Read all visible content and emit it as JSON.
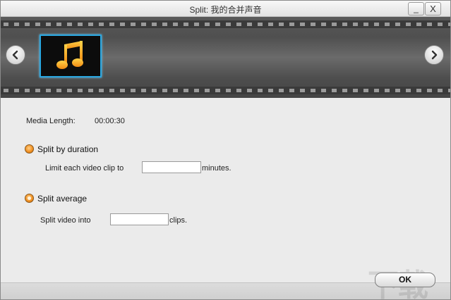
{
  "window": {
    "title": "Split: 我的合并声音",
    "minimize_label": "_",
    "close_label": "X"
  },
  "filmstrip": {
    "prev_icon": "chevron-left-icon",
    "next_icon": "chevron-right-icon",
    "selected_item_icon": "music-note-icon",
    "accent_color": "#2aa7e0"
  },
  "media": {
    "length_label": "Media Length:",
    "length_value": "00:00:30"
  },
  "split_by_duration": {
    "label": "Split by duration",
    "limit_label": "Limit each video clip to",
    "minutes_value": "",
    "minutes_unit": "minutes."
  },
  "split_average": {
    "label": "Split average",
    "selected": true,
    "into_label": "Split video into",
    "clips_value": "",
    "clips_unit": "clips."
  },
  "footer": {
    "ok_label": "OK"
  },
  "watermark": {
    "text": "下载吧"
  }
}
